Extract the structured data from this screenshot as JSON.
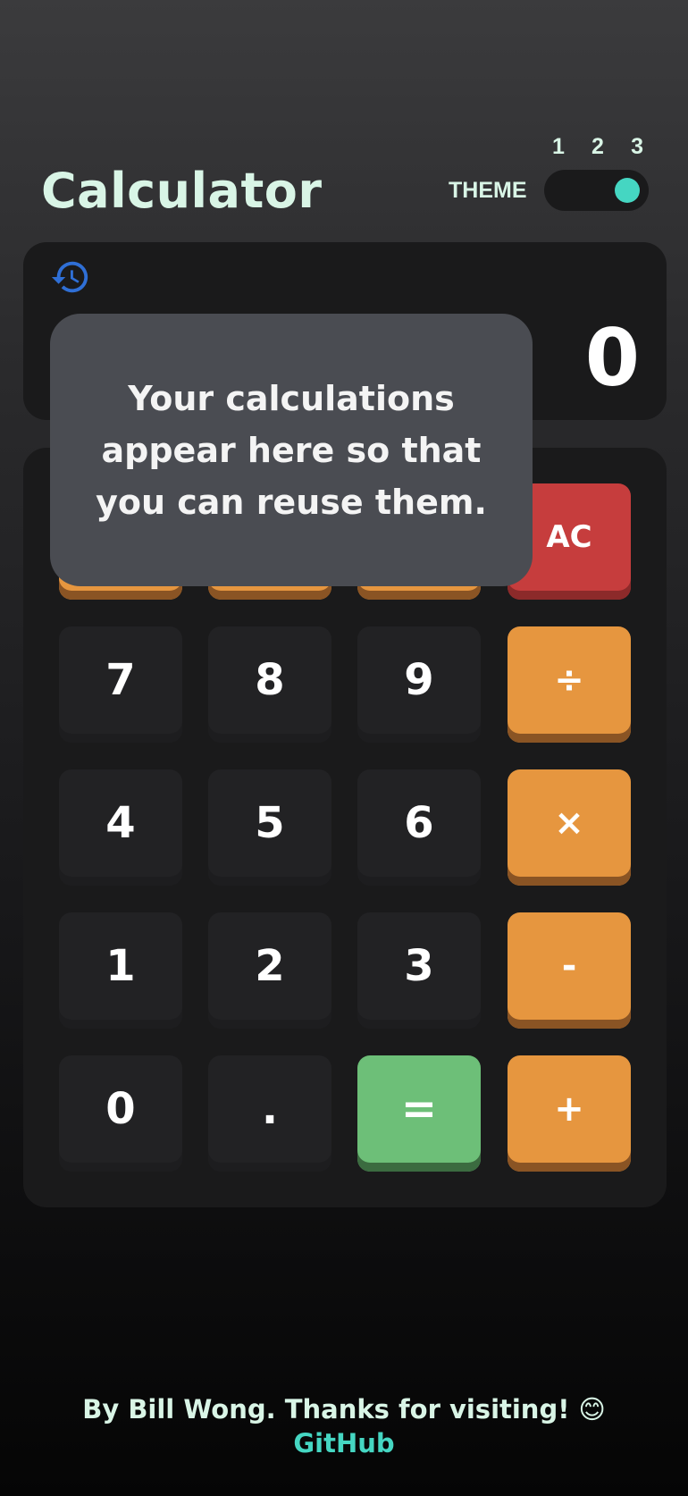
{
  "header": {
    "title": "Calculator",
    "theme_label": "THEME",
    "theme_options": [
      "1",
      "2",
      "3"
    ],
    "theme_selected": 3
  },
  "display": {
    "history_icon": "history-icon",
    "value": "0"
  },
  "tooltip": {
    "text": "Your calculations appear here so that you can reuse them."
  },
  "keypad": {
    "row1": {
      "clear": "AC"
    },
    "row2": {
      "k7": "7",
      "k8": "8",
      "k9": "9",
      "divide": "÷"
    },
    "row3": {
      "k4": "4",
      "k5": "5",
      "k6": "6",
      "multiply": "×"
    },
    "row4": {
      "k1": "1",
      "k2": "2",
      "k3": "3",
      "subtract": "-"
    },
    "row5": {
      "k0": "0",
      "decimal": ".",
      "equals": "=",
      "add": "+"
    }
  },
  "footer": {
    "credit": "By Bill Wong. Thanks for visiting! 😊",
    "github": "GitHub"
  },
  "colors": {
    "accent_teal": "#45d6c2",
    "title_mint": "#d9f5e6",
    "operator_orange": "#e6963f",
    "clear_red": "#c63d3d",
    "equals_green": "#6dbf78",
    "history_icon_blue": "#2f6fd6"
  }
}
